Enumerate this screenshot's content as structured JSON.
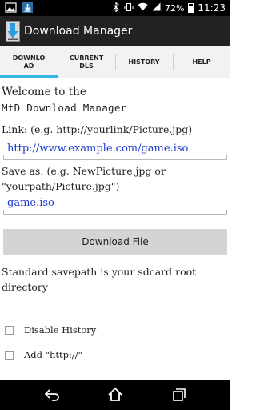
{
  "status_bar": {
    "battery_percent": "72%",
    "time": "11:23",
    "left_icons": [
      "image-notification-icon",
      "download-notification-icon"
    ],
    "right_icons": [
      "bluetooth-icon",
      "vibrate-icon",
      "wifi-icon",
      "signal-icon",
      "battery-icon"
    ]
  },
  "action_bar": {
    "title": "Download Manager",
    "icon": "download-arrow-icon"
  },
  "tabs": [
    {
      "label": "DOWNLO\nAD",
      "active": true
    },
    {
      "label": "CURRENT\nDLS",
      "active": false
    },
    {
      "label": "HISTORY",
      "active": false
    },
    {
      "label": "HELP",
      "active": false
    }
  ],
  "main": {
    "welcome_line1": "Welcome to the",
    "welcome_line2": "MtD Download Manager",
    "link_label": "Link: (e.g. http://yourlink/Picture.jpg)",
    "link_value": "http://www.example.com/game.iso",
    "save_label": "Save as: (e.g. NewPicture.jpg or \"yourpath/Picture.jpg\")",
    "save_value": "game.iso",
    "download_button": "Download File",
    "savepath_note": "Standard savepath is your sdcard root directory",
    "checkboxes": [
      {
        "label": "Disable History",
        "checked": false
      },
      {
        "label": "Add \"http://\"",
        "checked": false
      }
    ]
  },
  "nav_bar": {
    "icons": [
      "back-icon",
      "home-icon",
      "recent-apps-icon"
    ]
  },
  "colors": {
    "accent": "#33b5e5",
    "link_text": "#1a3ad0",
    "action_bar": "#222222"
  }
}
